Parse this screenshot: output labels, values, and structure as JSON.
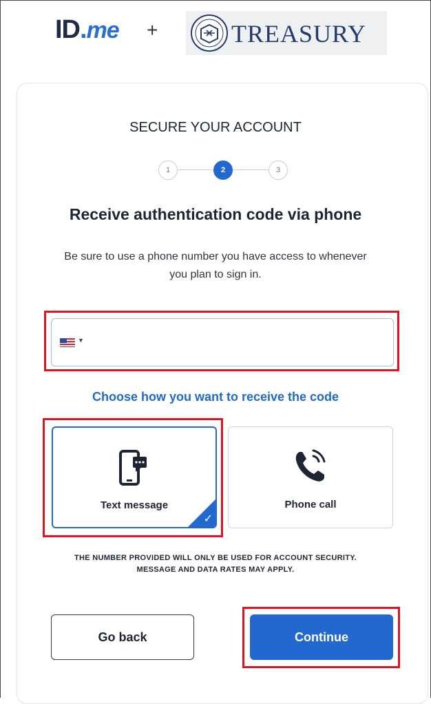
{
  "header": {
    "idme_logo_id": "ID",
    "idme_logo_dot": ".",
    "idme_logo_me": "me",
    "plus": "+",
    "treasury_text": "TREASURY"
  },
  "page": {
    "section_title": "SECURE YOUR ACCOUNT",
    "steps": [
      "1",
      "2",
      "3"
    ],
    "active_step": 2,
    "heading": "Receive authentication code via phone",
    "subtext": "Be sure to use a phone number you have access to whenever you plan to sign in."
  },
  "phone_input": {
    "country": "US",
    "value": ""
  },
  "delivery": {
    "prompt": "Choose how you want to receive the code",
    "options": [
      {
        "label": "Text message",
        "icon": "mobile-message-icon",
        "selected": true
      },
      {
        "label": "Phone call",
        "icon": "phone-call-icon",
        "selected": false
      }
    ]
  },
  "disclaimer": "THE NUMBER PROVIDED WILL ONLY BE USED FOR ACCOUNT SECURITY. MESSAGE AND DATA RATES MAY APPLY.",
  "buttons": {
    "back": "Go back",
    "continue": "Continue"
  },
  "colors": {
    "accent": "#2368cf",
    "highlight": "#e0141e"
  }
}
